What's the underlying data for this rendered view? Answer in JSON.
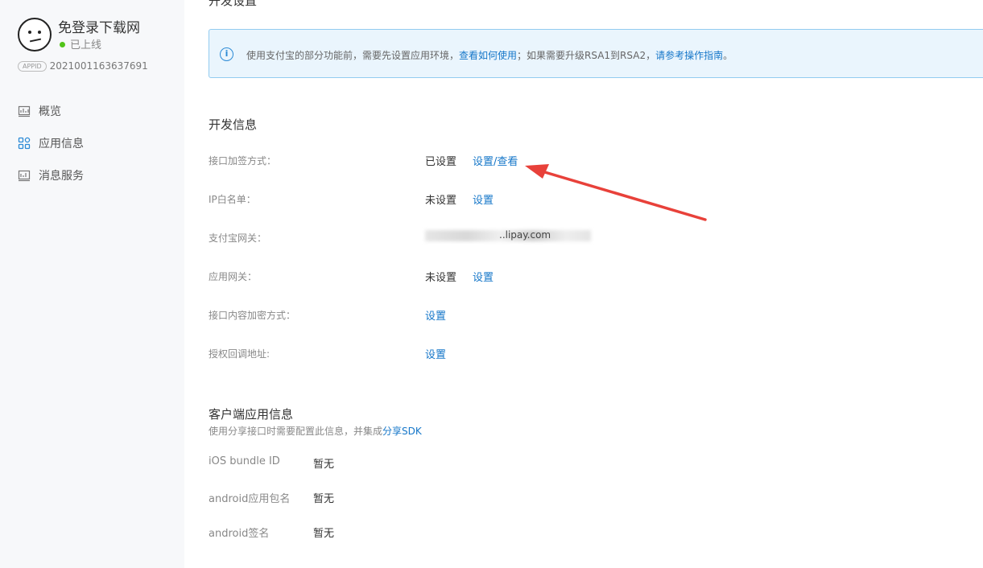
{
  "sidebar": {
    "app_name": "免登录下载网",
    "status": "已上线",
    "appid_badge": "APPID",
    "appid": "2021001163637691",
    "nav": [
      {
        "label": "概览",
        "icon": "overview-icon"
      },
      {
        "label": "应用信息",
        "icon": "apps-grid-icon"
      },
      {
        "label": "消息服务",
        "icon": "message-service-icon"
      }
    ]
  },
  "main": {
    "cut_title": "开发设置",
    "notice": {
      "text1": "使用支付宝的部分功能前，需要先设置应用环境，",
      "link1": "查看如何使用",
      "text2": "；如果需要升级RSA1到RSA2，",
      "link2": "请参考操作指南",
      "text3": "。"
    },
    "dev_info": {
      "title": "开发信息",
      "rows": [
        {
          "label": "接口加签方式：",
          "status": "已设置",
          "action": "设置/查看"
        },
        {
          "label": "IP白名单：",
          "status": "未设置",
          "action": "设置"
        },
        {
          "label": "支付宝网关：",
          "value": "..lipay.com"
        },
        {
          "label": "应用网关：",
          "status": "未设置",
          "action": "设置"
        },
        {
          "label": "接口内容加密方式：",
          "action": "设置"
        },
        {
          "label": "授权回调地址:",
          "action": "设置"
        }
      ]
    },
    "client_info": {
      "title": "客户端应用信息",
      "desc": "使用分享接口时需要配置此信息，并集成",
      "desc_link": "分享SDK",
      "rows": [
        {
          "label": "iOS bundle ID",
          "value": "暂无"
        },
        {
          "label": "android应用包名",
          "value": "暂无"
        },
        {
          "label": "android签名",
          "value": "暂无"
        }
      ]
    }
  },
  "colors": {
    "link": "#1677c9",
    "arrow": "#e8413a",
    "online": "#52c41a",
    "notice_bg": "#eaf5fd"
  }
}
